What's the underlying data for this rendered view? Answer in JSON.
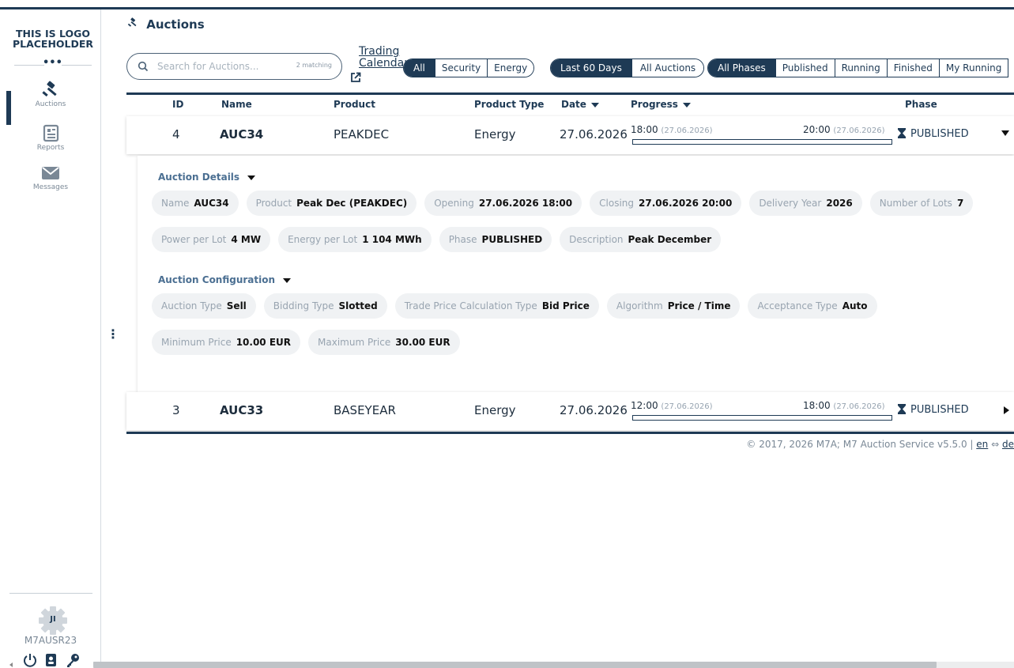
{
  "logo": {
    "text": "THIS IS LOGO PLACEHOLDER",
    "dots": "•••"
  },
  "sidebar": {
    "items": [
      {
        "label": "Auctions",
        "icon": "gavel-icon",
        "active": true
      },
      {
        "label": "Reports",
        "icon": "newspaper-icon",
        "active": false
      },
      {
        "label": "Messages",
        "icon": "envelope-icon",
        "active": false
      }
    ],
    "user": {
      "initials": "JI",
      "name": "M7AUSR23"
    }
  },
  "header": {
    "title": "Auctions"
  },
  "search": {
    "placeholder": "Search for Auctions...",
    "value": "",
    "count": "2 matching"
  },
  "trading_calendar": {
    "line1": "Trading",
    "line2": "Calendar"
  },
  "filters": {
    "type": [
      "All",
      "Security",
      "Energy"
    ],
    "period": [
      "Last 60 Days",
      "All Auctions"
    ],
    "phase": [
      "All Phases",
      "Published",
      "Running",
      "Finished",
      "My Running"
    ]
  },
  "table": {
    "columns": {
      "id": "ID",
      "name": "Name",
      "product": "Product",
      "product_type": "Product Type",
      "date": "Date",
      "progress": "Progress",
      "phase": "Phase"
    },
    "rows": [
      {
        "id": "4",
        "name": "AUC34",
        "product": "PEAKDEC",
        "product_type": "Energy",
        "date": "27.06.2026",
        "start_time": "18:00",
        "start_date": "(27.06.2026)",
        "end_time": "20:00",
        "end_date": "(27.06.2026)",
        "progress": 0,
        "phase": "PUBLISHED",
        "expanded": true
      },
      {
        "id": "3",
        "name": "AUC33",
        "product": "BASEYEAR",
        "product_type": "Energy",
        "date": "27.06.2026",
        "start_time": "12:00",
        "start_date": "(27.06.2026)",
        "end_time": "18:00",
        "end_date": "(27.06.2026)",
        "progress": 0,
        "phase": "PUBLISHED",
        "expanded": false
      }
    ]
  },
  "details": {
    "title": "Auction Details",
    "chips_row1": [
      {
        "k": "Name",
        "v": "AUC34"
      },
      {
        "k": "Product",
        "v": "Peak Dec (PEAKDEC)"
      },
      {
        "k": "Opening",
        "v": "27.06.2026 18:00"
      },
      {
        "k": "Closing",
        "v": "27.06.2026 20:00"
      },
      {
        "k": "Delivery Year",
        "v": "2026"
      },
      {
        "k": "Number of Lots",
        "v": "7"
      }
    ],
    "chips_row2": [
      {
        "k": "Power per Lot",
        "v": "4 MW"
      },
      {
        "k": "Energy per Lot",
        "v": "1 104 MWh"
      },
      {
        "k": "Phase",
        "v": "PUBLISHED"
      },
      {
        "k": "Description",
        "v": "Peak December"
      }
    ],
    "config_title": "Auction Configuration",
    "chips_row3": [
      {
        "k": "Auction Type",
        "v": "Sell"
      },
      {
        "k": "Bidding Type",
        "v": "Slotted"
      },
      {
        "k": "Trade Price Calculation Type",
        "v": "Bid Price"
      },
      {
        "k": "Algorithm",
        "v": "Price / Time"
      },
      {
        "k": "Acceptance Type",
        "v": "Auto"
      }
    ],
    "chips_row4": [
      {
        "k": "Minimum Price",
        "v": "10.00 EUR"
      },
      {
        "k": "Maximum Price",
        "v": "30.00 EUR"
      }
    ]
  },
  "footer": {
    "text": "© 2017, 2026 M7A; M7 Auction Service v5.5.0 |",
    "lang_en": "en",
    "swap": "⇔",
    "lang_de": "de"
  },
  "colors": {
    "primary": "#1e3a55",
    "chip_bg": "#f0f2f4",
    "muted": "#96a3b0"
  }
}
